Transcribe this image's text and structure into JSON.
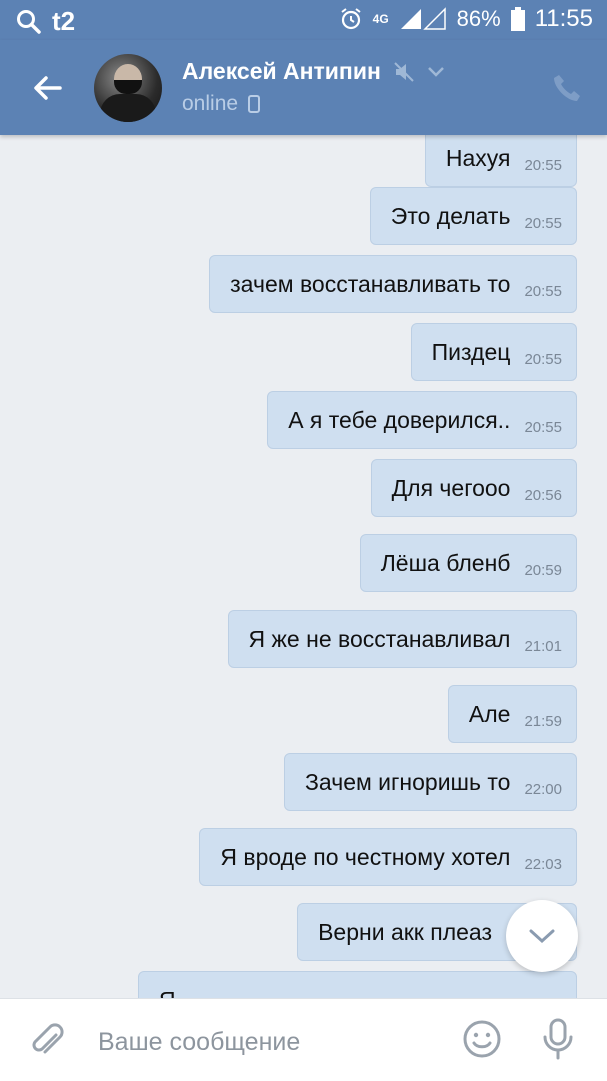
{
  "status_bar": {
    "carrier": "t2",
    "network": "4G",
    "battery": "86%",
    "time": "11:55",
    "icons": [
      "search-icon",
      "alarm-icon",
      "signal-icon",
      "battery-icon"
    ]
  },
  "header": {
    "contact_name": "Алексей Антипин",
    "presence": "online",
    "icons": [
      "back-arrow-icon",
      "mute-icon",
      "chevron-down-icon",
      "phone-icon",
      "mobile-device-icon"
    ]
  },
  "messages": [
    {
      "text": "Нахуя",
      "time": "20:55"
    },
    {
      "text": "Это делать",
      "time": "20:55"
    },
    {
      "text": "зачем восстанавливать то",
      "time": "20:55"
    },
    {
      "text": "Пиздец",
      "time": "20:55"
    },
    {
      "text": "А я тебе доверился..",
      "time": "20:55"
    },
    {
      "text": "Для чегооо",
      "time": "20:56"
    },
    {
      "text": "Лёша бленб",
      "time": "20:59"
    },
    {
      "text": "Я же не восстанавливал",
      "time": "21:01"
    },
    {
      "text": "Але",
      "time": "21:59"
    },
    {
      "text": "Зачем игноришь то",
      "time": "22:00"
    },
    {
      "text": "Я вроде по честному хотел",
      "time": "22:03"
    },
    {
      "text": "Верни акк плеаз",
      "time": ""
    },
    {
      "text": "Я",
      "time": ""
    }
  ],
  "composer": {
    "placeholder": "Ваше сообщение",
    "icons": [
      "paperclip-icon",
      "emoji-icon",
      "microphone-icon"
    ]
  },
  "colors": {
    "header": "#5c82b4",
    "bubble": "#cfdff0",
    "background": "#ebeef2"
  }
}
